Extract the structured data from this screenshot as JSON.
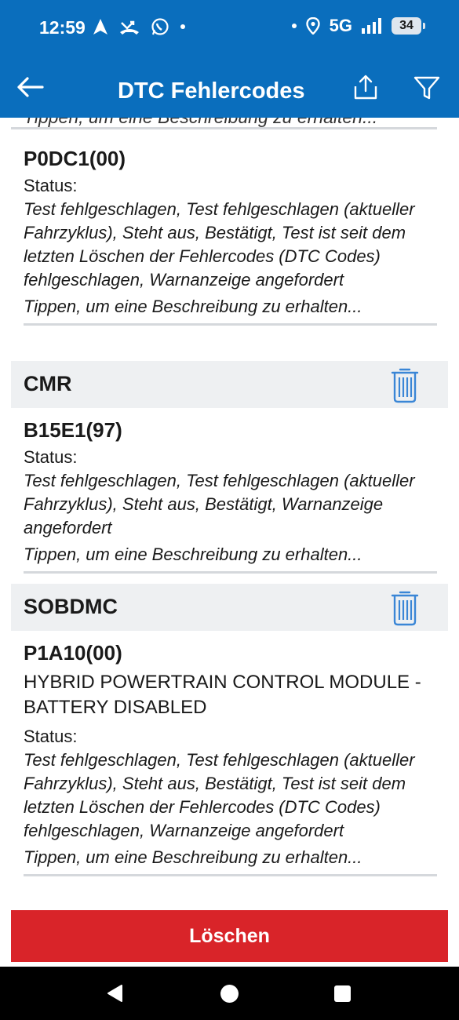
{
  "status_bar": {
    "time": "12:59",
    "network": "5G",
    "battery": "34"
  },
  "app_bar": {
    "title": "DTC Fehlercodes"
  },
  "partial_entry": {
    "tap_hint": "Tippen, um eine Beschreibung zu erhalten..."
  },
  "entries": [
    {
      "code": "P0DC1(00)",
      "status_label": "Status:",
      "status_text": " Test fehlgeschlagen, Test fehlgeschlagen (aktueller Fahrzyklus), Steht aus, Bestätigt, Test ist seit dem letzten Löschen der Fehlercodes (DTC Codes) fehlgeschlagen, Warnanzeige angefordert",
      "tap_hint": "Tippen, um eine Beschreibung zu erhalten..."
    }
  ],
  "groups": [
    {
      "name": "CMR",
      "entry": {
        "code": "B15E1(97)",
        "status_label": "Status:",
        "status_text": " Test fehlgeschlagen, Test fehlgeschlagen (aktueller Fahrzyklus), Steht aus, Bestätigt, Warnanzeige angefordert",
        "tap_hint": "Tippen, um eine Beschreibung zu erhalten..."
      }
    },
    {
      "name": "SOBDMC",
      "entry": {
        "code": "P1A10(00)",
        "description": "HYBRID POWERTRAIN CONTROL MODULE - BATTERY DISABLED",
        "status_label": "Status:",
        "status_text": " Test fehlgeschlagen, Test fehlgeschlagen (aktueller Fahrzyklus), Steht aus, Bestätigt, Test ist seit dem letzten Löschen der Fehlercodes (DTC Codes) fehlgeschlagen, Warnanzeige angefordert",
        "tap_hint": "Tippen, um eine Beschreibung zu erhalten..."
      }
    }
  ],
  "delete_button": {
    "label": "Löschen"
  },
  "colors": {
    "primary": "#0a6ebd",
    "danger": "#d92429",
    "group_bg": "#eef0f2",
    "icon_blue": "#3a86d6"
  },
  "icons": [
    "back-arrow-icon",
    "share-icon",
    "filter-icon",
    "trash-icon",
    "navigation-icon",
    "missed-call-icon",
    "whatsapp-icon",
    "location-icon",
    "signal-icon",
    "battery-icon"
  ]
}
